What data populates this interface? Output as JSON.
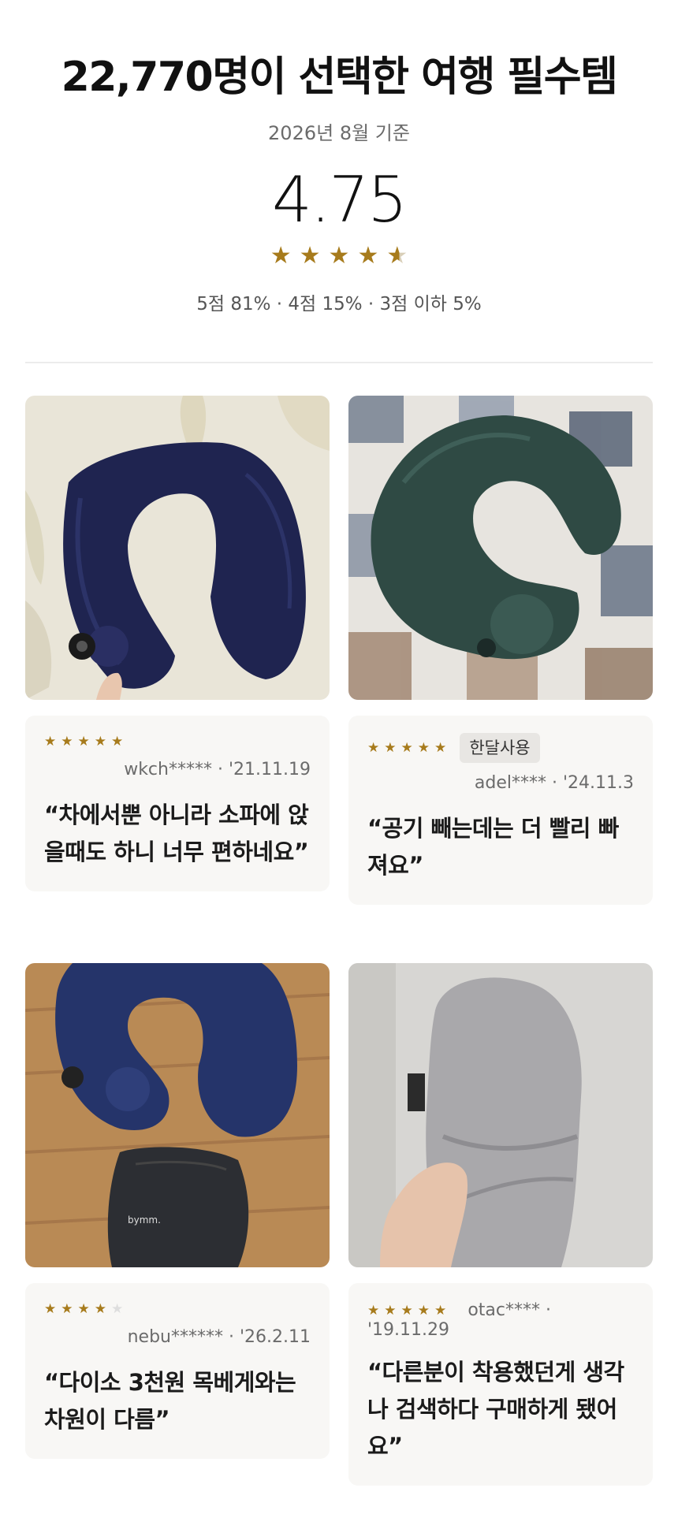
{
  "header": {
    "headline": "22,770명이 선택한 여행 필수템",
    "as_of": "2026년 8월 기준",
    "rating": "4.75",
    "distribution": "5점 81% · 4점 15% · 3점 이하 5%"
  },
  "colors": {
    "star": "#a77b1c",
    "card_bg": "#f8f7f5"
  },
  "reviews": [
    {
      "stars": 5,
      "user": "wkch*****",
      "date": "'21.11.19",
      "badge": "",
      "quote": "“차에서뿐 아니라 소파에 앉을때도 하니 너무 편하네요”",
      "photo": "navy-inflatable-neck-pillow-on-wallpaper"
    },
    {
      "stars": 5,
      "user": "adel****",
      "date": "'24.11.3",
      "badge": "한달사용",
      "quote": "“공기 빼는데는 더 빨리 빠져요”",
      "photo": "green-velvet-neck-pillow-on-checkered-blanket"
    },
    {
      "stars": 4,
      "user": "nebu******",
      "date": "'26.2.11",
      "badge": "",
      "quote": "“다이소 3천원 목베게와는 차원이 다름”",
      "photo": "navy-neck-pillow-with-pouch-on-wood-floor",
      "pouch_text": "bymm."
    },
    {
      "stars": 5,
      "user": "otac****",
      "date": "'19.11.29",
      "badge": "",
      "quote": "“다른분이 착용했던게 생각나 검색하다 구매하게 됐어요”",
      "photo": "grey-plush-pillow-folded-in-hand"
    }
  ]
}
